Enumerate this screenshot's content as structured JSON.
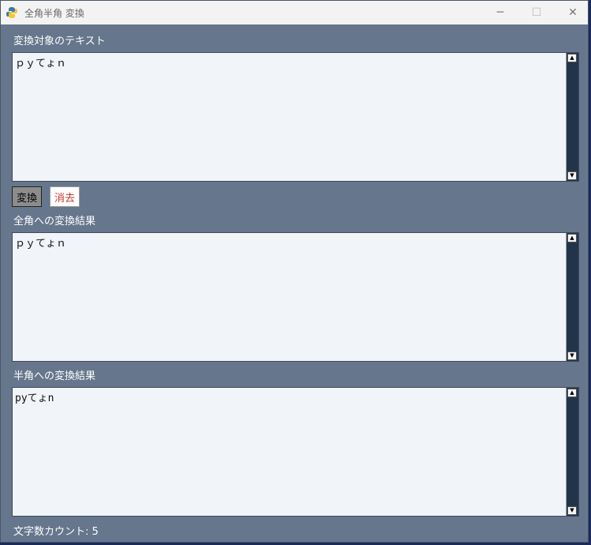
{
  "window": {
    "title": "全角半角 変換",
    "minimize": "─",
    "maximize": "☐",
    "close": "✕"
  },
  "input": {
    "label": "変換対象のテキスト",
    "value": "ｐｙてょｎ"
  },
  "buttons": {
    "convert": "変換",
    "clear": "消去"
  },
  "fullwidth": {
    "label": "全角への変換結果",
    "value": "ｐｙてょｎ"
  },
  "halfwidth": {
    "label": "半角への変換結果",
    "value": "pyてょn"
  },
  "status": {
    "char_count": "文字数カウント: 5"
  },
  "scroll": {
    "up": "▲",
    "down": "▼"
  }
}
